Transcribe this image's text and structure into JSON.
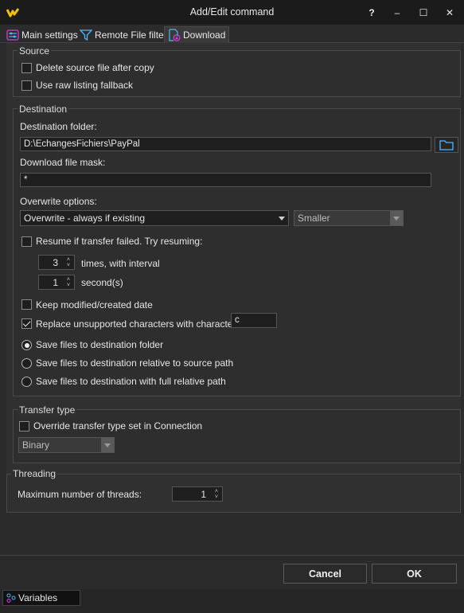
{
  "window": {
    "title": "Add/Edit command",
    "help_label": "?",
    "minimize_label": "–",
    "maximize_label": "☐",
    "close_label": "✕"
  },
  "tabs": [
    {
      "label": "Main settings",
      "icon": "settings-sliders-icon",
      "active": false
    },
    {
      "label": "Remote File filter",
      "icon": "funnel-icon",
      "active": false
    },
    {
      "label": "Download",
      "icon": "download-document-icon",
      "active": true
    }
  ],
  "source": {
    "title": "Source",
    "delete_after_copy": {
      "label": "Delete source file after copy",
      "checked": false
    },
    "raw_listing": {
      "label": "Use raw listing fallback",
      "checked": false
    }
  },
  "destination": {
    "title": "Destination",
    "folder_label": "Destination folder:",
    "folder_value": "D:\\EchangesFichiers\\PayPal",
    "mask_label": "Download file mask:",
    "mask_value": "*",
    "overwrite_label": "Overwrite options:",
    "overwrite_value": "Overwrite - always if existing",
    "overwrite_cond_value": "Smaller",
    "resume": {
      "label": "Resume if transfer failed. Try resuming:",
      "checked": false
    },
    "times_value": "3",
    "times_label": "times, with interval",
    "seconds_value": "1",
    "seconds_label": "second(s)",
    "keep_date": {
      "label": "Keep modified/created date",
      "checked": false
    },
    "replace_chars": {
      "label": "Replace unsupported characters with character:",
      "checked": true,
      "value": "c"
    },
    "save_options": [
      {
        "label": "Save files to destination folder",
        "selected": true
      },
      {
        "label": "Save files to destination relative to source path",
        "selected": false
      },
      {
        "label": "Save files to destination with full relative path",
        "selected": false
      }
    ]
  },
  "transfer": {
    "title": "Transfer type",
    "override": {
      "label": "Override transfer type set in Connection",
      "checked": false
    },
    "type_value": "Binary"
  },
  "threading": {
    "title": "Threading",
    "max_threads_label": "Maximum number of threads:",
    "max_threads_value": "1"
  },
  "buttons": {
    "cancel": "Cancel",
    "ok": "OK"
  },
  "statusbar": {
    "variables_label": "Variables"
  },
  "colors": {
    "background": "#2b2b2b",
    "panel": "#303030",
    "input": "#1f1f1f",
    "accent_icon": "#4db8ff",
    "app_icon": "#f2c200"
  }
}
